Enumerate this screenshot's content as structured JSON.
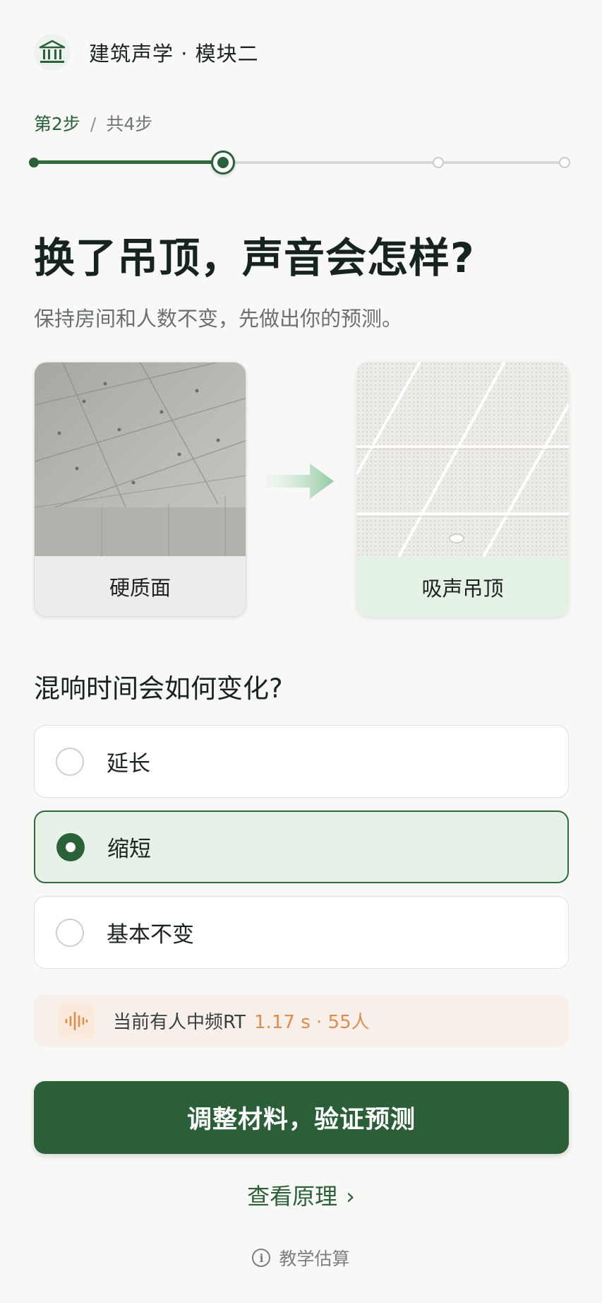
{
  "header": {
    "title": "建筑声学 · 模块二",
    "icon": "building-columns-icon"
  },
  "steps": {
    "current_label": "第2步",
    "separator": "/",
    "total_label": "共4步",
    "current": 2,
    "total": 4
  },
  "headline": "换了吊顶，声音会怎样?",
  "subtitle": "保持房间和人数不变，先做出你的预测。",
  "materials": {
    "before": {
      "label": "硬质面",
      "image": "concrete-ceiling-image"
    },
    "after": {
      "label": "吸声吊顶",
      "image": "acoustic-ceiling-tiles-image"
    },
    "arrow_icon": "arrow-right-icon"
  },
  "question": "混响时间会如何变化?",
  "options": [
    {
      "label": "延长",
      "selected": false
    },
    {
      "label": "缩短",
      "selected": true
    },
    {
      "label": "基本不变",
      "selected": false
    }
  ],
  "info": {
    "icon": "sound-wave-icon",
    "label": "当前有人中频RT",
    "value": "1.17 s · 55人"
  },
  "cta": {
    "label": "调整材料，验证预测"
  },
  "link": {
    "label": "查看原理",
    "icon": "chevron-right-icon"
  },
  "footnote": {
    "label": "教学估算",
    "icon": "info-icon"
  },
  "colors": {
    "primary": "#2a5f38",
    "selected_bg": "#e6f1e7",
    "accent_orange": "#e08c4a",
    "background": "#f8f8f7"
  }
}
